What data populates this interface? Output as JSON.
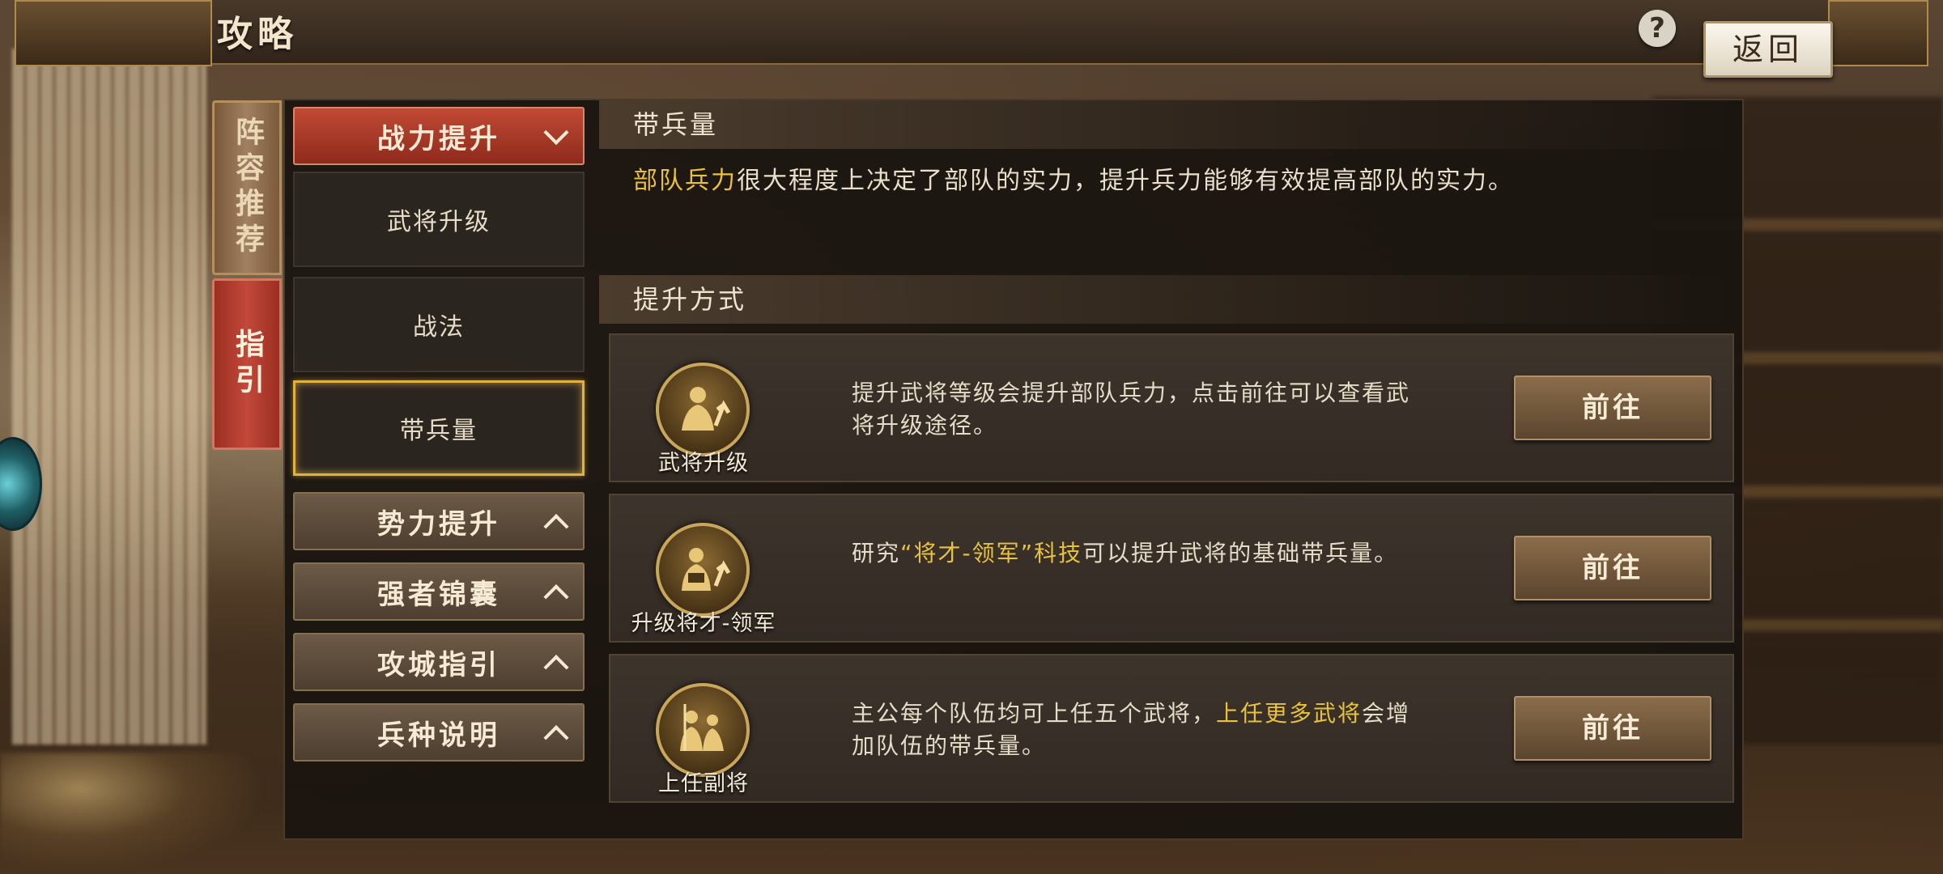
{
  "header": {
    "title": "攻略",
    "help_label": "?",
    "back_label": "返回"
  },
  "side_tabs": [
    {
      "label": "阵容推荐"
    },
    {
      "label": "指引"
    }
  ],
  "nav": {
    "cat_power": "战力提升",
    "sub_items": [
      "武将升级",
      "战法",
      "带兵量"
    ],
    "cat_faction": "势力提升",
    "cat_tips": "强者锦囊",
    "cat_siege": "攻城指引",
    "cat_units": "兵种说明"
  },
  "content": {
    "section_title": "带兵量",
    "desc_highlight": "部队兵力",
    "desc_rest": "很大程度上决定了部队的实力，提升兵力能够有效提高部队的实力。",
    "method_title": "提升方式",
    "cards": [
      {
        "icon": "general-upgrade-icon",
        "label": "武将升级",
        "text_pre": "提升武将等级会提升部队兵力，点击前往可以查看武将升级途径。",
        "text_hl": "",
        "text_post": "",
        "button": "前往"
      },
      {
        "icon": "commander-tech-icon",
        "label": "升级将才-领军",
        "text_pre": "研究",
        "text_hl": "“将才-领军”科技",
        "text_post": "可以提升武将的基础带兵量。",
        "button": "前往"
      },
      {
        "icon": "vice-general-icon",
        "label": "上任副将",
        "text_pre": "主公每个队伍均可上任五个武将，",
        "text_hl": "上任更多武将",
        "text_post": "会增加队伍的带兵量。",
        "button": "前往"
      }
    ]
  },
  "colors": {
    "highlight": "#e8c23e",
    "active_red": "#c14a35",
    "selected_gold": "#e0b040"
  }
}
